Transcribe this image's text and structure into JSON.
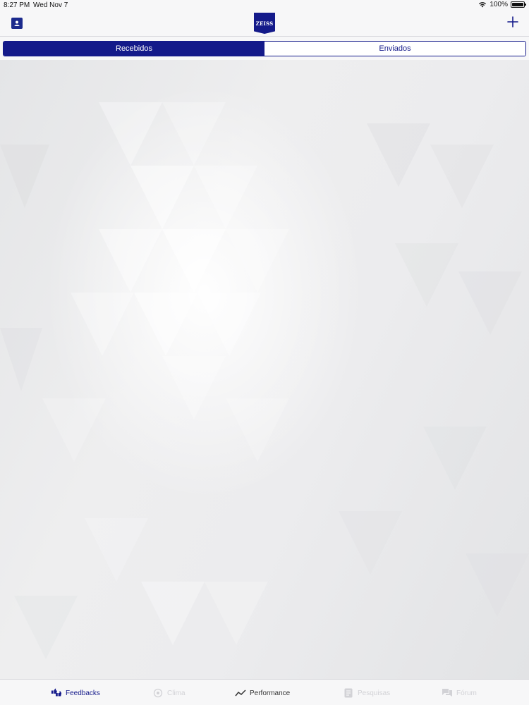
{
  "status_bar": {
    "time": "8:27 PM",
    "date": "Wed Nov 7",
    "battery": "100%"
  },
  "header": {
    "logo_text": "ZEISS"
  },
  "segments": [
    {
      "label": "Recebidos",
      "selected": true
    },
    {
      "label": "Enviados",
      "selected": false
    }
  ],
  "tabs": [
    {
      "label": "Feedbacks",
      "icon": "thumbs-icon",
      "state": "active"
    },
    {
      "label": "Clima",
      "icon": "clima-icon",
      "state": "disabled"
    },
    {
      "label": "Performance",
      "icon": "trend-icon",
      "state": "normal"
    },
    {
      "label": "Pesquisas",
      "icon": "document-icon",
      "state": "disabled"
    },
    {
      "label": "Fórum",
      "icon": "chat-icon",
      "state": "disabled"
    }
  ],
  "colors": {
    "accent": "#141a8a",
    "background": "#f7f7f8",
    "disabled": "#d2d2d6"
  }
}
